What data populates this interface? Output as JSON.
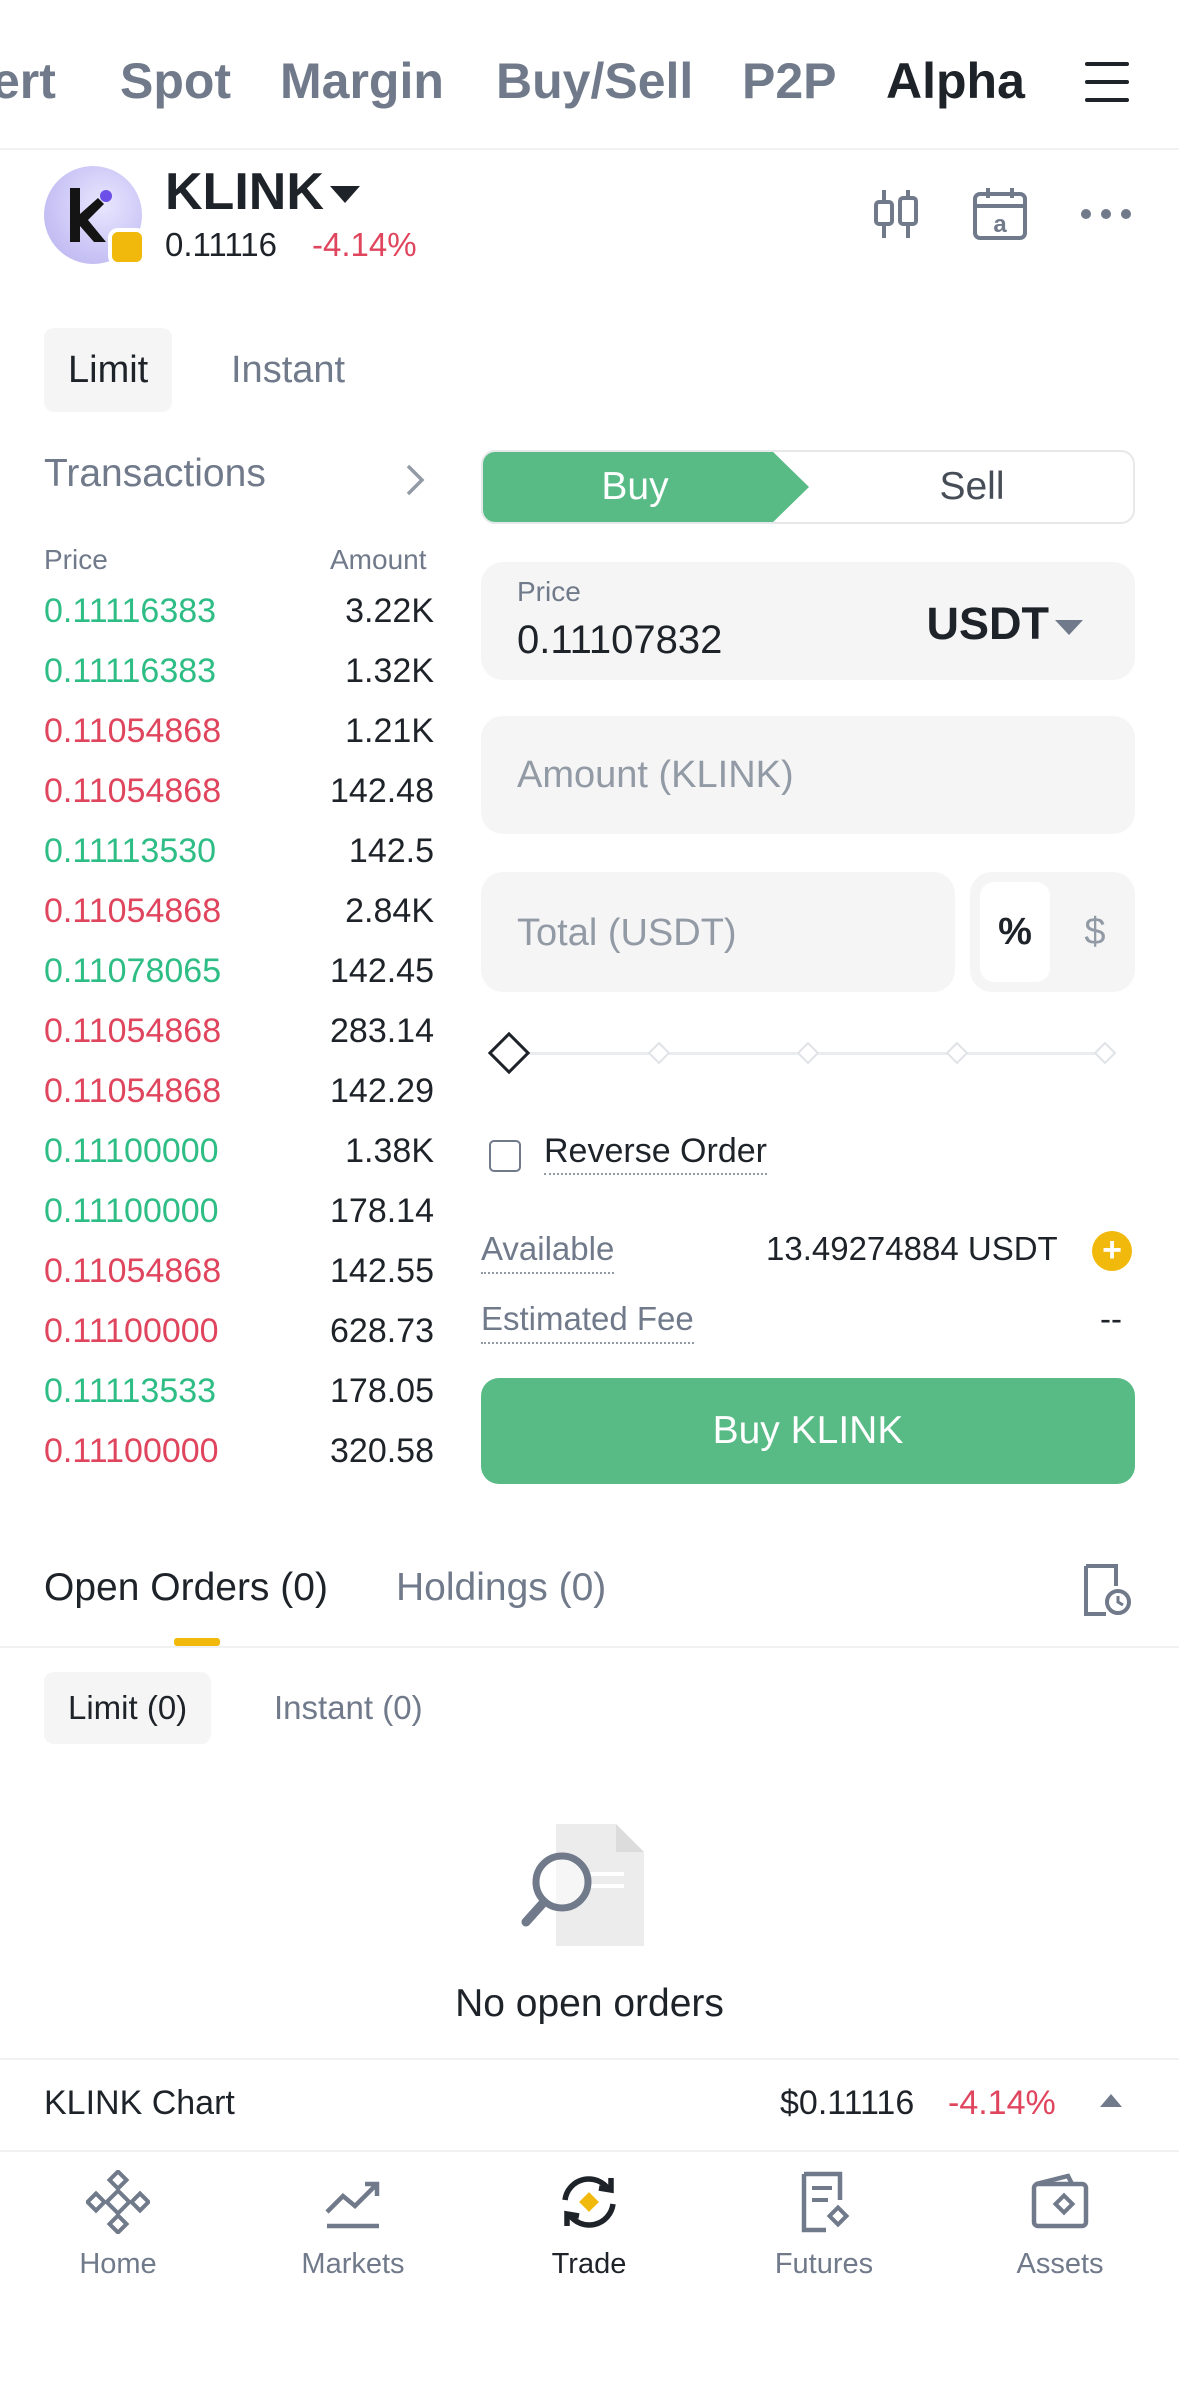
{
  "top_tabs": [
    {
      "label": "Convert",
      "visible_label": "ert"
    },
    {
      "label": "Spot"
    },
    {
      "label": "Margin"
    },
    {
      "label": "Buy/Sell"
    },
    {
      "label": "P2P"
    },
    {
      "label": "Alpha",
      "active": true
    }
  ],
  "token": {
    "name": "KLINK",
    "price": "0.11116",
    "change": "-4.14%"
  },
  "order_types": {
    "limit": "Limit",
    "instant": "Instant"
  },
  "transactions": {
    "title": "Transactions",
    "price_header": "Price",
    "amount_header": "Amount",
    "rows": [
      {
        "price": "0.11116383",
        "amount": "3.22K",
        "side": "buy"
      },
      {
        "price": "0.11116383",
        "amount": "1.32K",
        "side": "buy"
      },
      {
        "price": "0.11054868",
        "amount": "1.21K",
        "side": "sell"
      },
      {
        "price": "0.11054868",
        "amount": "142.48",
        "side": "sell"
      },
      {
        "price": "0.11113530",
        "amount": "142.5",
        "side": "buy"
      },
      {
        "price": "0.11054868",
        "amount": "2.84K",
        "side": "sell"
      },
      {
        "price": "0.11078065",
        "amount": "142.45",
        "side": "buy"
      },
      {
        "price": "0.11054868",
        "amount": "283.14",
        "side": "sell"
      },
      {
        "price": "0.11054868",
        "amount": "142.29",
        "side": "sell"
      },
      {
        "price": "0.11100000",
        "amount": "1.38K",
        "side": "buy"
      },
      {
        "price": "0.11100000",
        "amount": "178.14",
        "side": "buy"
      },
      {
        "price": "0.11054868",
        "amount": "142.55",
        "side": "sell"
      },
      {
        "price": "0.11100000",
        "amount": "628.73",
        "side": "sell"
      },
      {
        "price": "0.11113533",
        "amount": "178.05",
        "side": "buy"
      },
      {
        "price": "0.11100000",
        "amount": "320.58",
        "side": "sell"
      }
    ]
  },
  "trade_form": {
    "buy_label": "Buy",
    "sell_label": "Sell",
    "price_label": "Price",
    "price_value": "0.11107832",
    "quote_currency": "USDT",
    "amount_placeholder": "Amount (KLINK)",
    "total_placeholder": "Total (USDT)",
    "unit_percent": "%",
    "unit_dollar": "$",
    "slider_percent": 0,
    "reverse_order_label": "Reverse Order",
    "available_label": "Available",
    "available_value": "13.49274884 USDT",
    "fee_label": "Estimated Fee",
    "fee_value": "--",
    "submit_label": "Buy KLINK"
  },
  "orders": {
    "open_orders_tab": "Open Orders (0)",
    "holdings_tab": "Holdings (0)",
    "limit_tab": "Limit (0)",
    "instant_tab": "Instant (0)",
    "empty_text": "No open orders"
  },
  "chart_strip": {
    "title": "KLINK Chart",
    "price": "$0.11116",
    "change": "-4.14%"
  },
  "bottom_nav": [
    {
      "label": "Home"
    },
    {
      "label": "Markets"
    },
    {
      "label": "Trade",
      "active": true
    },
    {
      "label": "Futures"
    },
    {
      "label": "Assets"
    }
  ],
  "colors": {
    "buy_green": "#58bb85",
    "price_green": "#2ebd85",
    "sell_red": "#e0455e",
    "accent_yellow": "#f0b90b",
    "text_primary": "#1e2329",
    "text_secondary": "#707a8a"
  }
}
